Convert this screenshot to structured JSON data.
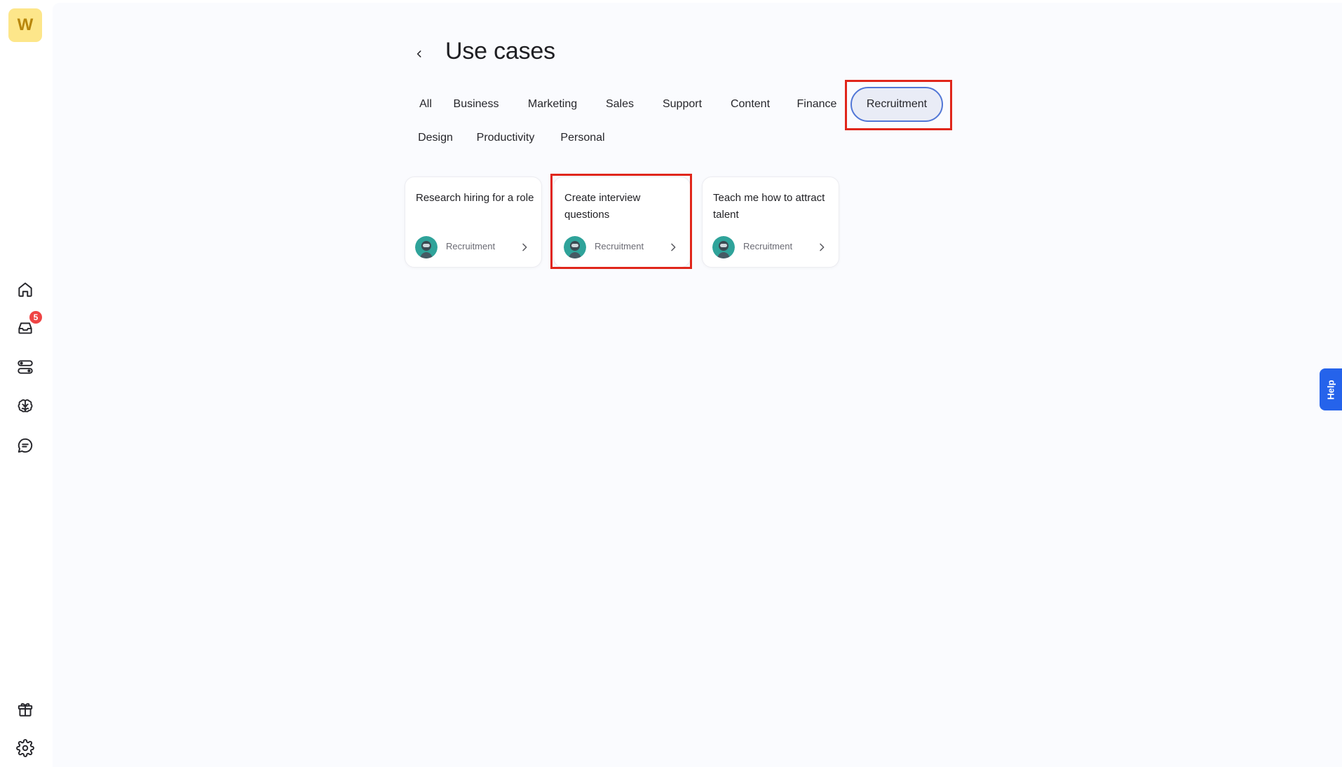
{
  "sidebar": {
    "logo_letter": "W",
    "nav": [
      {
        "name": "home-icon"
      },
      {
        "name": "inbox-icon",
        "badge": "5"
      },
      {
        "name": "apps-icon"
      },
      {
        "name": "brain-icon"
      },
      {
        "name": "chat-icon"
      }
    ],
    "bottom": [
      {
        "name": "gift-icon"
      },
      {
        "name": "settings-icon"
      }
    ]
  },
  "header": {
    "title": "Use cases"
  },
  "categories": [
    {
      "label": "All",
      "active": false
    },
    {
      "label": "Business",
      "active": false
    },
    {
      "label": "Marketing",
      "active": false
    },
    {
      "label": "Sales",
      "active": false
    },
    {
      "label": "Support",
      "active": false
    },
    {
      "label": "Content",
      "active": false
    },
    {
      "label": "Finance",
      "active": false
    },
    {
      "label": "Recruitment",
      "active": true
    },
    {
      "label": "Design",
      "active": false
    },
    {
      "label": "Productivity",
      "active": false
    },
    {
      "label": "Personal",
      "active": false
    }
  ],
  "cards": [
    {
      "title": "Research hiring for a role",
      "tag": "Recruitment"
    },
    {
      "title": "Create interview questions",
      "tag": "Recruitment"
    },
    {
      "title": "Teach me how to attract talent",
      "tag": "Recruitment"
    }
  ],
  "help": {
    "label": "Help"
  },
  "colors": {
    "highlight": "#e0261b",
    "active_tab_border": "#5277d6",
    "help_button": "#2563eb",
    "logo_bg": "#fde68a"
  }
}
